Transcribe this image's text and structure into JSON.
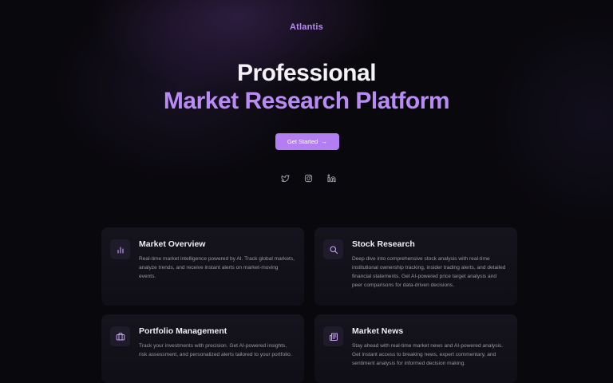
{
  "brand": {
    "name": "Atlantis"
  },
  "hero": {
    "title_line1": "Professional",
    "title_line2": "Market Research Platform",
    "cta_label": "Get Started",
    "cta_icon": "arrow-right-icon"
  },
  "socials": [
    {
      "icon": "twitter-icon"
    },
    {
      "icon": "instagram-icon"
    },
    {
      "icon": "linkedin-icon"
    }
  ],
  "features": [
    {
      "icon": "bar-chart-icon",
      "title": "Market Overview",
      "description": "Real-time market intelligence powered by AI. Track global markets, analyze trends, and receive instant alerts on market-moving events."
    },
    {
      "icon": "search-icon",
      "title": "Stock Research",
      "description": "Deep dive into comprehensive stock analysis with real-time institutional ownership tracking, insider trading alerts, and detailed financial statements. Get AI-powered price target analysis and peer comparisons for data-driven decisions."
    },
    {
      "icon": "briefcase-icon",
      "title": "Portfolio Management",
      "description": "Track your investments with precision. Get AI-powered insights, risk assessment, and personalized alerts tailored to your portfolio."
    },
    {
      "icon": "newspaper-icon",
      "title": "Market News",
      "description": "Stay ahead with real-time market news and AI-powered analysis. Get instant access to breaking news, expert commentary, and sentiment analysis for informed decision making."
    }
  ],
  "colors": {
    "background": "#09080c",
    "accent": "#b27ef2",
    "accent_text": "#b98bf4",
    "card": "#16141e",
    "muted_text": "#9a96a6"
  }
}
